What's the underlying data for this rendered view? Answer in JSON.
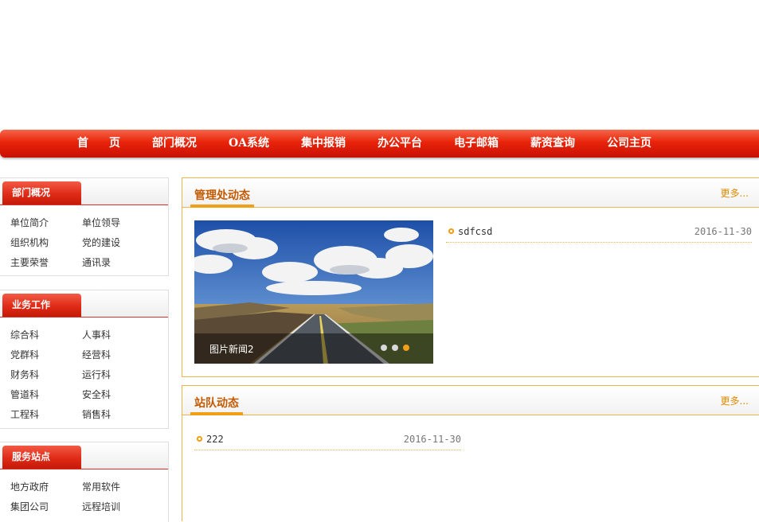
{
  "nav": {
    "items": [
      "首　页",
      "部门概况",
      "OA系统",
      "集中报销",
      "办公平台",
      "电子邮箱",
      "薪资查询",
      "公司主页"
    ]
  },
  "sidebar": {
    "sections": [
      {
        "title": "部门概况",
        "links": [
          "单位简介",
          "单位领导",
          "组织机构",
          "党的建设",
          "主要荣誉",
          "通讯录"
        ]
      },
      {
        "title": "业务工作",
        "links": [
          "综合科",
          "人事科",
          "党群科",
          "经营科",
          "财务科",
          "运行科",
          "管道科",
          "安全科",
          "工程科",
          "销售科"
        ]
      },
      {
        "title": "服务站点",
        "links": [
          "地方政府",
          "常用软件",
          "集团公司",
          "远程培训"
        ]
      }
    ]
  },
  "management": {
    "title": "管理处动态",
    "more": "更多...",
    "slide_caption": "图片新闻2",
    "slide_total": 3,
    "slide_active": 3,
    "news": [
      {
        "title": "sdfcsd",
        "date": "2016-11-30"
      }
    ]
  },
  "team": {
    "title": "站队动态",
    "more": "更多...",
    "news": [
      {
        "title": "222",
        "date": "2016-11-30"
      }
    ]
  },
  "colors": {
    "nav_red": "#e8240a",
    "title_orange": "#c35a00",
    "accent_gold": "#f0a018"
  }
}
